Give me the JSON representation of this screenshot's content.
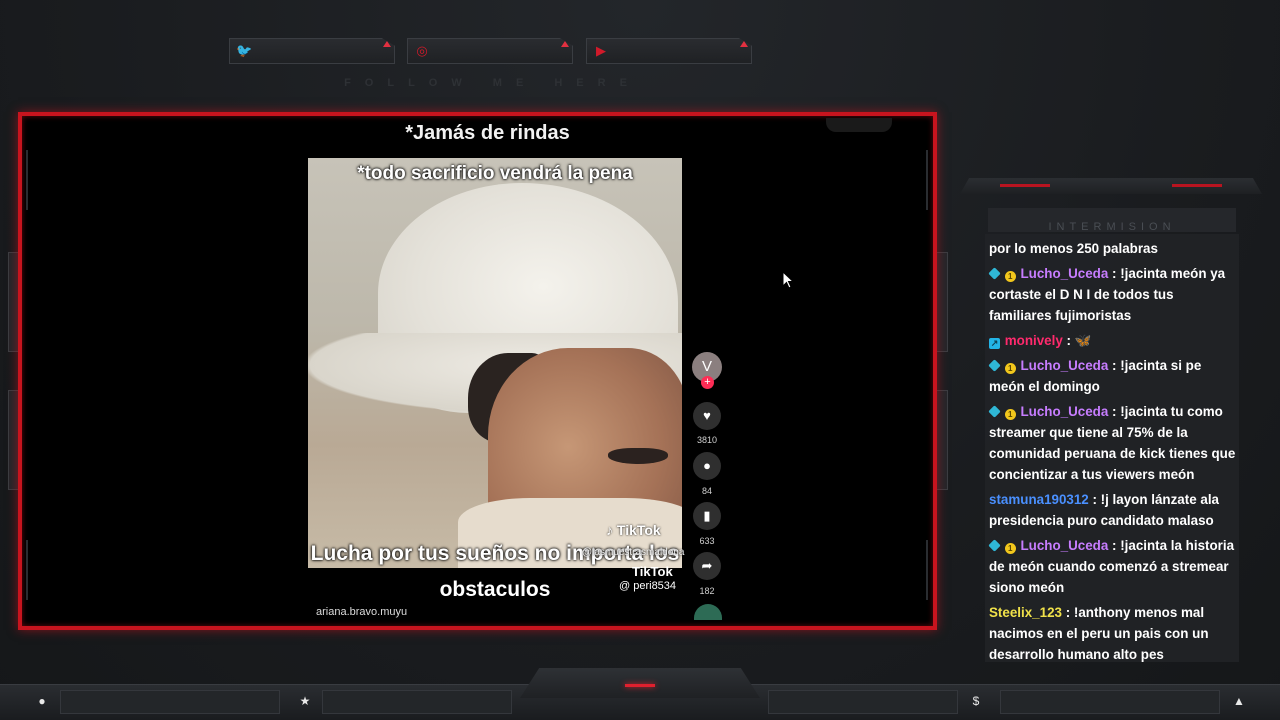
{
  "social": {
    "follow_text": "FOLLOW ME HERE",
    "links": [
      {
        "icon": "twitter-icon",
        "glyph": "🐦"
      },
      {
        "icon": "instagram-icon",
        "glyph": "◎"
      },
      {
        "icon": "youtube-icon",
        "glyph": "▶"
      }
    ]
  },
  "video": {
    "title": "*Jamás de rindas",
    "top_caption": "*todo sacrificio vendrá la pena",
    "bottom_caption": "Lucha por tus sueños no importa los obstaculos",
    "tiktok_logo": "TikTok",
    "tiktok_handle_1": "@lasmuestrasmaldona",
    "tiktok_logo_2": "TikTok",
    "tiktok_handle_2": "@ peri8534",
    "username": "ariana.bravo.muyu",
    "avatar_letter": "V",
    "plus": "+",
    "likes": "3810",
    "comments": "84",
    "saves": "633",
    "shares": "182"
  },
  "panel": {
    "intermission_label": "INTERMISION"
  },
  "chat": [
    {
      "badges": [],
      "user": "",
      "user_color": "#ffffff",
      "sep": "",
      "message": "por lo menos 250 palabras"
    },
    {
      "badges": [
        "gem",
        "coin"
      ],
      "user": "Lucho_Uceda",
      "user_color": "#c77dff",
      "sep": " : ",
      "message": "!jacinta meón ya cortaste el D N I de todos tus familiares fujimoristas"
    },
    {
      "badges": [
        "arrow"
      ],
      "user": "monively",
      "user_color": "#ff2a6d",
      "sep": " : ",
      "message": "🦋"
    },
    {
      "badges": [
        "gem",
        "coin"
      ],
      "user": "Lucho_Uceda",
      "user_color": "#c77dff",
      "sep": " : ",
      "message": "!jacinta si pe meón el domingo"
    },
    {
      "badges": [
        "gem",
        "coin"
      ],
      "user": "Lucho_Uceda",
      "user_color": "#c77dff",
      "sep": " : ",
      "message": "!jacinta tu como streamer que tiene al 75% de la comunidad peruana de kick tienes que concientizar a tus viewers meón"
    },
    {
      "badges": [],
      "user": "stamuna190312",
      "user_color": "#4a90ff",
      "sep": " : ",
      "message": "!j layon lánzate ala presidencia puro candidato malaso"
    },
    {
      "badges": [
        "gem",
        "coin"
      ],
      "user": "Lucho_Uceda",
      "user_color": "#c77dff",
      "sep": " : ",
      "message": "!jacinta la historia de meón cuando comenzó a stremear siono meón"
    },
    {
      "badges": [],
      "user": "Steelix_123",
      "user_color": "#f0e14a",
      "sep": " : ",
      "message": "!anthony menos mal nacimos en el peru un pais con un desarrollo humano alto pes"
    }
  ],
  "bottom_bar": {
    "icons": [
      {
        "name": "user-icon",
        "glyph": "●"
      },
      {
        "name": "star-icon",
        "glyph": "★"
      },
      {
        "name": "dollar-icon",
        "glyph": "$"
      },
      {
        "name": "flame-icon",
        "glyph": "▲"
      }
    ]
  },
  "colors": {
    "accent": "#c8141e",
    "background": "#1b1d20"
  }
}
